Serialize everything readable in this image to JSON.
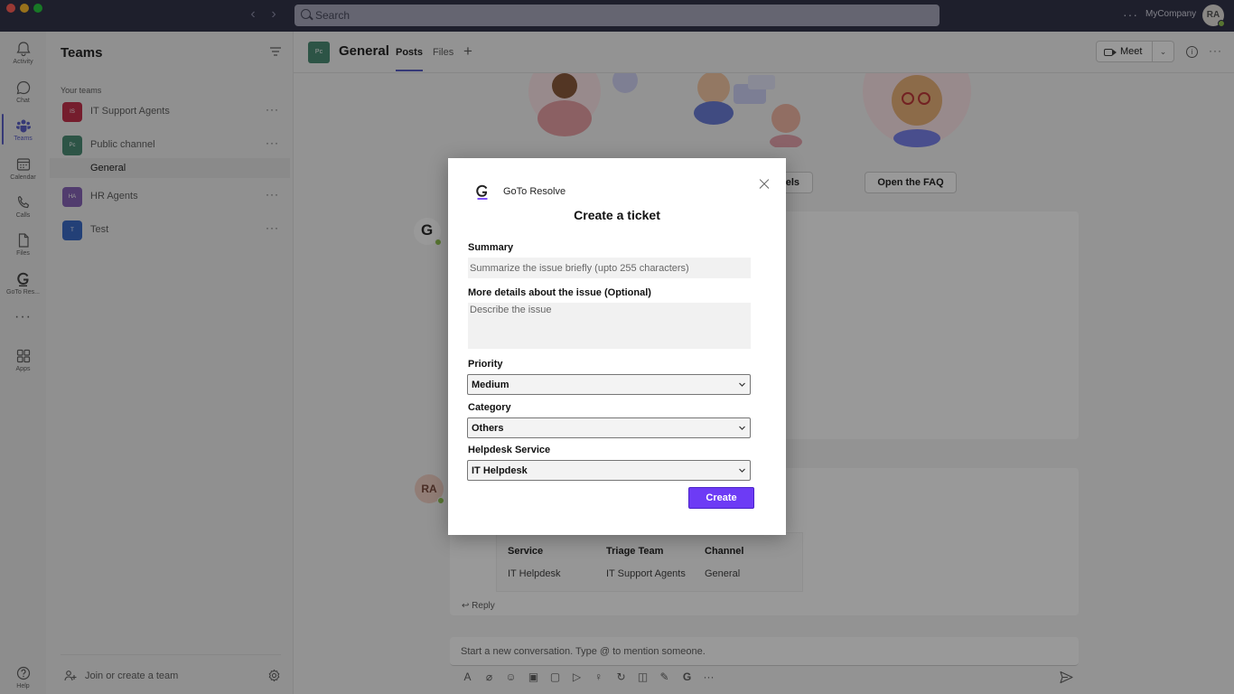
{
  "titlebar": {
    "search_placeholder": "Search",
    "more": "···",
    "company": "MyCompany",
    "user_initials": "RA"
  },
  "rail": {
    "items": [
      {
        "label": "Activity",
        "icon": "bell-icon"
      },
      {
        "label": "Chat",
        "icon": "chat-icon"
      },
      {
        "label": "Teams",
        "icon": "teams-icon"
      },
      {
        "label": "Calendar",
        "icon": "calendar-icon"
      },
      {
        "label": "Calls",
        "icon": "phone-icon"
      },
      {
        "label": "Files",
        "icon": "file-icon"
      },
      {
        "label": "GoTo Res...",
        "icon": "goto-resolve-icon"
      },
      {
        "label": "Apps",
        "icon": "apps-icon"
      },
      {
        "label": "Help",
        "icon": "help-icon"
      }
    ],
    "more": "···",
    "active_index": 2
  },
  "teams_panel": {
    "title": "Teams",
    "section_label": "Your teams",
    "teams": [
      {
        "name": "IT Support Agents",
        "abbr": "IS",
        "color": "#c4314b"
      },
      {
        "name": "Public channel",
        "abbr": "Pc",
        "color": "#4b8d76"
      },
      {
        "name": "HR Agents",
        "abbr": "HA",
        "color": "#8764b8"
      },
      {
        "name": "Test",
        "abbr": "T",
        "color": "#3b6bc7"
      }
    ],
    "selected_channel": "General",
    "join_label": "Join or create a team",
    "more": "···"
  },
  "channel": {
    "avatar_abbr": "Pc",
    "name": "General",
    "tabs": [
      "Posts",
      "Files"
    ],
    "add_tab": "+",
    "meet_label": "Meet",
    "more": "···"
  },
  "content": {
    "card_buttons": [
      "nels",
      "Open the FAQ"
    ],
    "bot_initial": "G",
    "user_initials": "RA",
    "table": {
      "headers": [
        "Service",
        "Triage Team",
        "Channel"
      ],
      "row": [
        "IT Helpdesk",
        "IT Support Agents",
        "General"
      ]
    },
    "reply_label": "Reply",
    "compose_placeholder": "Start a new conversation. Type @ to mention someone."
  },
  "modal": {
    "brand": "GoTo Resolve",
    "title": "Create a ticket",
    "summary_label": "Summary",
    "summary_placeholder": "Summarize the issue briefly (upto 255 characters)",
    "details_label": "More details about the issue (Optional)",
    "details_placeholder": "Describe the issue",
    "priority_label": "Priority",
    "priority_value": "Medium",
    "category_label": "Category",
    "category_value": "Others",
    "helpdesk_label": "Helpdesk Service",
    "helpdesk_value": "IT Helpdesk",
    "create_label": "Create",
    "accent_color": "#6d3bf5"
  }
}
